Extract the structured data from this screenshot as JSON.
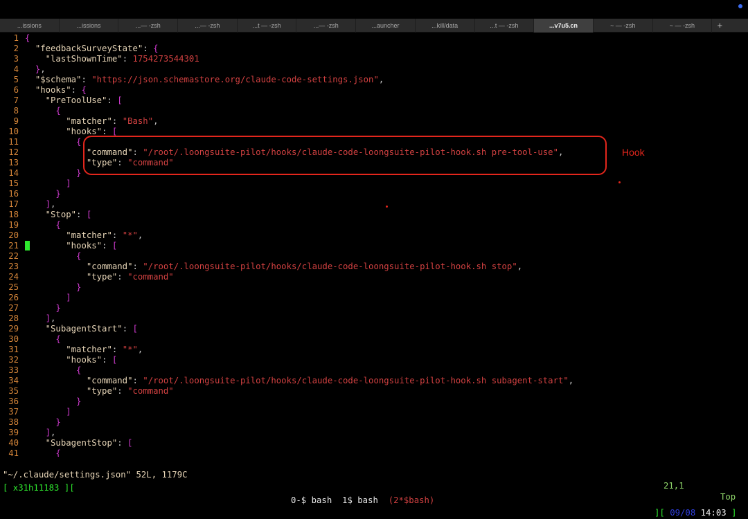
{
  "tabs": [
    "...issions",
    "...issions",
    "...— -zsh",
    "...— -zsh",
    "...t — -zsh",
    "...— -zsh",
    "...auncher",
    "...kill/data",
    "...t — -zsh",
    "...v7u5.cn",
    "~ — -zsh",
    "~ — -zsh"
  ],
  "active_tab_index": 9,
  "new_tab_label": "+",
  "lines": [
    {
      "n": "1",
      "t": [
        [
          "br",
          "{"
        ]
      ]
    },
    {
      "n": "2",
      "t": [
        [
          "pun",
          "  "
        ],
        [
          "key",
          "\"feedbackSurveyState\""
        ],
        [
          "pun",
          ": "
        ],
        [
          "br",
          "{"
        ]
      ]
    },
    {
      "n": "3",
      "t": [
        [
          "pun",
          "    "
        ],
        [
          "key",
          "\"lastShownTime\""
        ],
        [
          "pun",
          ": "
        ],
        [
          "num",
          "1754273544301"
        ]
      ]
    },
    {
      "n": "4",
      "t": [
        [
          "pun",
          "  "
        ],
        [
          "br",
          "}"
        ],
        [
          "pun",
          ","
        ]
      ]
    },
    {
      "n": "5",
      "t": [
        [
          "pun",
          "  "
        ],
        [
          "key",
          "\"$schema\""
        ],
        [
          "pun",
          ": "
        ],
        [
          "str",
          "\"https://json.schemastore.org/claude-code-settings.json\""
        ],
        [
          "pun",
          ","
        ]
      ]
    },
    {
      "n": "6",
      "t": [
        [
          "pun",
          "  "
        ],
        [
          "key",
          "\"hooks\""
        ],
        [
          "pun",
          ": "
        ],
        [
          "br",
          "{"
        ]
      ]
    },
    {
      "n": "7",
      "t": [
        [
          "pun",
          "    "
        ],
        [
          "key",
          "\"PreToolUse\""
        ],
        [
          "pun",
          ": "
        ],
        [
          "br",
          "["
        ]
      ]
    },
    {
      "n": "8",
      "t": [
        [
          "pun",
          "      "
        ],
        [
          "br",
          "{"
        ]
      ]
    },
    {
      "n": "9",
      "t": [
        [
          "pun",
          "        "
        ],
        [
          "key",
          "\"matcher\""
        ],
        [
          "pun",
          ": "
        ],
        [
          "str",
          "\"Bash\""
        ],
        [
          "pun",
          ","
        ]
      ]
    },
    {
      "n": "10",
      "t": [
        [
          "pun",
          "        "
        ],
        [
          "key",
          "\"hooks\""
        ],
        [
          "pun",
          ": "
        ],
        [
          "br",
          "["
        ]
      ]
    },
    {
      "n": "11",
      "t": [
        [
          "pun",
          "          "
        ],
        [
          "br",
          "{"
        ]
      ]
    },
    {
      "n": "12",
      "t": [
        [
          "pun",
          "            "
        ],
        [
          "key",
          "\"command\""
        ],
        [
          "pun",
          ": "
        ],
        [
          "str",
          "\"/root/.loongsuite-pilot/hooks/claude-code-loongsuite-pilot-hook.sh pre-tool-use\""
        ],
        [
          "pun",
          ","
        ]
      ]
    },
    {
      "n": "13",
      "t": [
        [
          "pun",
          "            "
        ],
        [
          "key",
          "\"type\""
        ],
        [
          "pun",
          ": "
        ],
        [
          "str",
          "\"command\""
        ]
      ]
    },
    {
      "n": "14",
      "t": [
        [
          "pun",
          "          "
        ],
        [
          "br",
          "}"
        ]
      ]
    },
    {
      "n": "15",
      "t": [
        [
          "pun",
          "        "
        ],
        [
          "br",
          "]"
        ]
      ]
    },
    {
      "n": "16",
      "t": [
        [
          "pun",
          "      "
        ],
        [
          "br",
          "}"
        ]
      ]
    },
    {
      "n": "17",
      "t": [
        [
          "pun",
          "    "
        ],
        [
          "br",
          "]"
        ],
        [
          "pun",
          ","
        ]
      ]
    },
    {
      "n": "18",
      "t": [
        [
          "pun",
          "    "
        ],
        [
          "key",
          "\"Stop\""
        ],
        [
          "pun",
          ": "
        ],
        [
          "br",
          "["
        ]
      ]
    },
    {
      "n": "19",
      "t": [
        [
          "pun",
          "      "
        ],
        [
          "br",
          "{"
        ]
      ]
    },
    {
      "n": "20",
      "t": [
        [
          "pun",
          "        "
        ],
        [
          "key",
          "\"matcher\""
        ],
        [
          "pun",
          ": "
        ],
        [
          "str",
          "\"*\""
        ],
        [
          "pun",
          ","
        ]
      ]
    },
    {
      "n": "21",
      "t": [
        [
          "pun",
          "        "
        ],
        [
          "key",
          "\"hooks\""
        ],
        [
          "pun",
          ": "
        ],
        [
          "br",
          "["
        ]
      ]
    },
    {
      "n": "22",
      "t": [
        [
          "pun",
          "          "
        ],
        [
          "br",
          "{"
        ]
      ]
    },
    {
      "n": "23",
      "t": [
        [
          "pun",
          "            "
        ],
        [
          "key",
          "\"command\""
        ],
        [
          "pun",
          ": "
        ],
        [
          "str",
          "\"/root/.loongsuite-pilot/hooks/claude-code-loongsuite-pilot-hook.sh stop\""
        ],
        [
          "pun",
          ","
        ]
      ]
    },
    {
      "n": "24",
      "t": [
        [
          "pun",
          "            "
        ],
        [
          "key",
          "\"type\""
        ],
        [
          "pun",
          ": "
        ],
        [
          "str",
          "\"command\""
        ]
      ]
    },
    {
      "n": "25",
      "t": [
        [
          "pun",
          "          "
        ],
        [
          "br",
          "}"
        ]
      ]
    },
    {
      "n": "26",
      "t": [
        [
          "pun",
          "        "
        ],
        [
          "br",
          "]"
        ]
      ]
    },
    {
      "n": "27",
      "t": [
        [
          "pun",
          "      "
        ],
        [
          "br",
          "}"
        ]
      ]
    },
    {
      "n": "28",
      "t": [
        [
          "pun",
          "    "
        ],
        [
          "br",
          "]"
        ],
        [
          "pun",
          ","
        ]
      ]
    },
    {
      "n": "29",
      "t": [
        [
          "pun",
          "    "
        ],
        [
          "key",
          "\"SubagentStart\""
        ],
        [
          "pun",
          ": "
        ],
        [
          "br",
          "["
        ]
      ]
    },
    {
      "n": "30",
      "t": [
        [
          "pun",
          "      "
        ],
        [
          "br",
          "{"
        ]
      ]
    },
    {
      "n": "31",
      "t": [
        [
          "pun",
          "        "
        ],
        [
          "key",
          "\"matcher\""
        ],
        [
          "pun",
          ": "
        ],
        [
          "str",
          "\"*\""
        ],
        [
          "pun",
          ","
        ]
      ]
    },
    {
      "n": "32",
      "t": [
        [
          "pun",
          "        "
        ],
        [
          "key",
          "\"hooks\""
        ],
        [
          "pun",
          ": "
        ],
        [
          "br",
          "["
        ]
      ]
    },
    {
      "n": "33",
      "t": [
        [
          "pun",
          "          "
        ],
        [
          "br",
          "{"
        ]
      ]
    },
    {
      "n": "34",
      "t": [
        [
          "pun",
          "            "
        ],
        [
          "key",
          "\"command\""
        ],
        [
          "pun",
          ": "
        ],
        [
          "str",
          "\"/root/.loongsuite-pilot/hooks/claude-code-loongsuite-pilot-hook.sh subagent-start\""
        ],
        [
          "pun",
          ","
        ]
      ]
    },
    {
      "n": "35",
      "t": [
        [
          "pun",
          "            "
        ],
        [
          "key",
          "\"type\""
        ],
        [
          "pun",
          ": "
        ],
        [
          "str",
          "\"command\""
        ]
      ]
    },
    {
      "n": "36",
      "t": [
        [
          "pun",
          "          "
        ],
        [
          "br",
          "}"
        ]
      ]
    },
    {
      "n": "37",
      "t": [
        [
          "pun",
          "        "
        ],
        [
          "br",
          "]"
        ]
      ]
    },
    {
      "n": "38",
      "t": [
        [
          "pun",
          "      "
        ],
        [
          "br",
          "}"
        ]
      ]
    },
    {
      "n": "39",
      "t": [
        [
          "pun",
          "    "
        ],
        [
          "br",
          "]"
        ],
        [
          "pun",
          ","
        ]
      ]
    },
    {
      "n": "40",
      "t": [
        [
          "pun",
          "    "
        ],
        [
          "key",
          "\"SubagentStop\""
        ],
        [
          "pun",
          ": "
        ],
        [
          "br",
          "["
        ]
      ]
    },
    {
      "n": "41",
      "t": [
        [
          "pun",
          "      "
        ],
        [
          "br",
          "{"
        ]
      ]
    }
  ],
  "cursor_line": "21",
  "annotation_label": "Hook",
  "status": {
    "filename": "\"~/.claude/settings.json\" 52L, 1179C",
    "position": "21,1",
    "scroll": "Top"
  },
  "tmux": {
    "session": "[ x31h11183 ][",
    "window0": "0-$ bash",
    "window1": "1$ bash",
    "window2": "(2*$bash)",
    "clock_open": "][",
    "date": "09/08",
    "time": "14:03",
    "clock_close": "]"
  },
  "colors": {
    "background": "#000000",
    "line_number": "#d7873a",
    "brace": "#d03bd0",
    "key": "#e8d6b8",
    "string": "#d24141",
    "cursor": "#2ee82e",
    "annotation": "#e3261c"
  }
}
